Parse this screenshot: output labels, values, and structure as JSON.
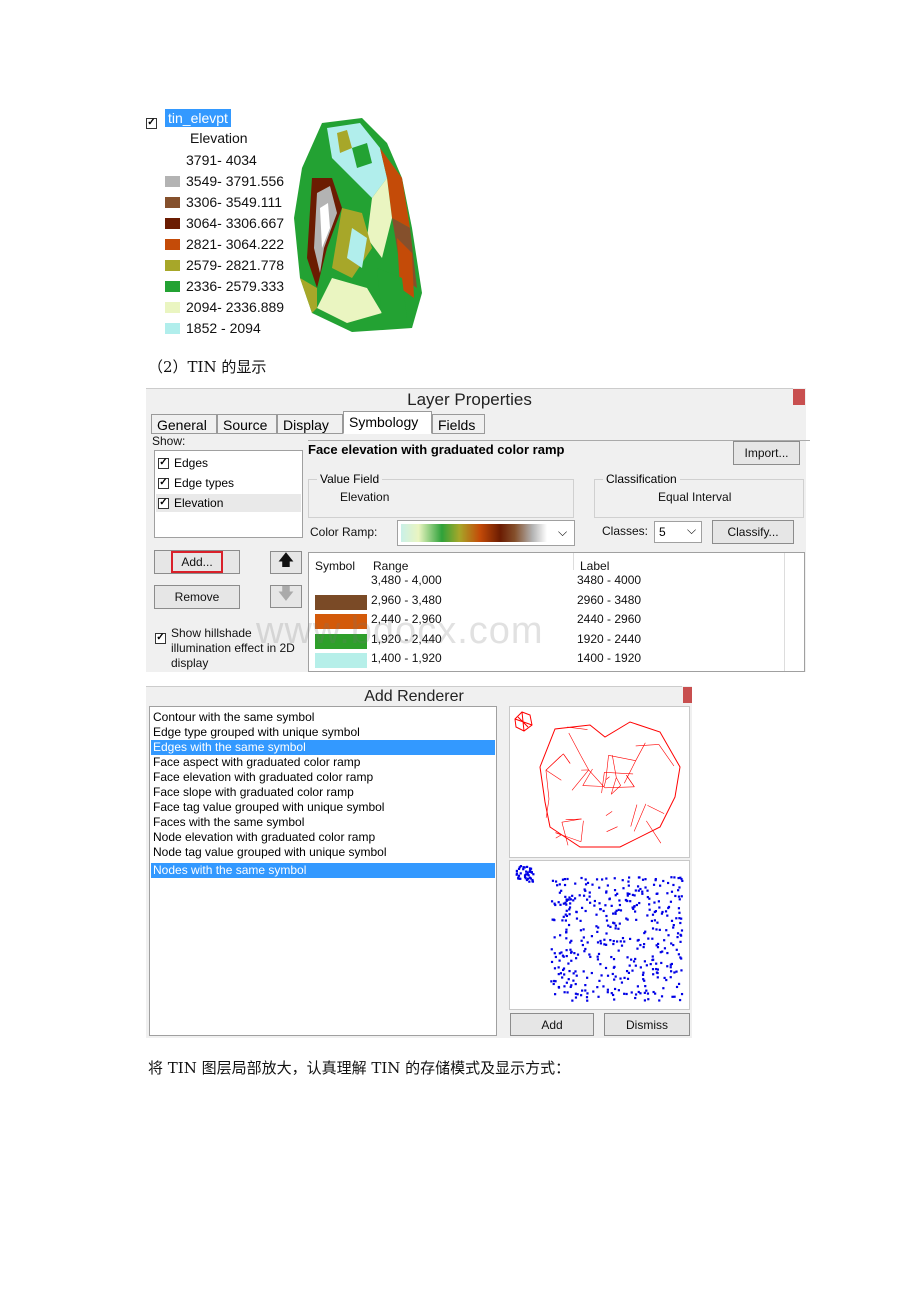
{
  "legend": {
    "layer_name": "tin_elevpt",
    "field": "Elevation",
    "items": [
      {
        "label": "3791- 4034",
        "color": "#ffffff"
      },
      {
        "label": "3549- 3791.556",
        "color": "#b3b3b3"
      },
      {
        "label": "3306- 3549.111",
        "color": "#85502c"
      },
      {
        "label": "3064- 3306.667",
        "color": "#6b1c02"
      },
      {
        "label": "2821- 3064.222",
        "color": "#c44b08"
      },
      {
        "label": "2579- 2821.778",
        "color": "#a7a729"
      },
      {
        "label": "2336- 2579.333",
        "color": "#23a233"
      },
      {
        "label": "2094- 2336.889",
        "color": "#eaf5c1"
      },
      {
        "label": "1852 - 2094",
        "color": "#b1eeec"
      }
    ]
  },
  "caption1": "（2）TIN 的显示",
  "layer_props": {
    "title": "Layer Properties",
    "tabs": [
      "General",
      "Source",
      "Display",
      "Symbology",
      "Fields"
    ],
    "active_tab": "Symbology",
    "show_label": "Show:",
    "show_items": [
      "Edges",
      "Edge types",
      "Elevation"
    ],
    "renderer_title": "Face elevation with graduated color ramp",
    "import_btn": "Import...",
    "value_field_label": "Value Field",
    "value_field": "Elevation",
    "classification_label": "Classification",
    "classification": "Equal Interval",
    "color_ramp_label": "Color Ramp:",
    "classes_label": "Classes:",
    "classes_value": "5",
    "classify_btn": "Classify...",
    "add_btn": "Add...",
    "remove_btn": "Remove",
    "hillshade": "Show hillshade illumination effect in 2D display",
    "table_headers": [
      "Symbol",
      "Range",
      "Label"
    ],
    "rows": [
      {
        "range": "3,480 - 4,000",
        "label": "3480 - 4000",
        "color": "#ffffff"
      },
      {
        "range": "2,960 - 3,480",
        "label": "2960 - 3480",
        "color": "#7a4a26"
      },
      {
        "range": "2,440 - 2,960",
        "label": "2440 - 2960",
        "color": "#d35a0a"
      },
      {
        "range": "1,920 - 2,440",
        "label": "1920 - 2440",
        "color": "#2e9f2a"
      },
      {
        "range": "1,400 - 1,920",
        "label": "1400 - 1920",
        "color": "#b6efe9"
      }
    ],
    "watermark": "www.bdocx.com"
  },
  "add_renderer": {
    "title": "Add Renderer",
    "items": [
      "Contour with the same symbol",
      "Edge type grouped with unique symbol",
      "Edges with the same symbol",
      "Face aspect with graduated color ramp",
      "Face elevation with graduated color ramp",
      "Face slope with graduated color ramp",
      "Face tag value grouped with unique symbol",
      "Faces with the same symbol",
      "Node elevation with graduated color ramp",
      "Node tag value grouped with unique symbol",
      "Nodes with the same symbol"
    ],
    "selected": [
      "Edges with the same symbol",
      "Nodes with the same symbol"
    ],
    "add_btn": "Add",
    "dismiss_btn": "Dismiss"
  },
  "caption2": "将 TIN 图层局部放大，认真理解 TIN 的存储模式及显示方式："
}
